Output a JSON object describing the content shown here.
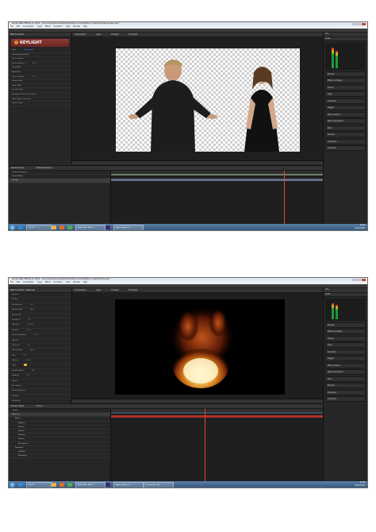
{
  "shot1": {
    "title": "Adobe After Effects CC 2014 - \\uk.local\\uk\\student\\student\\U\\Documents\\Motion Graphics\\Greenscreen.aep *",
    "menu": [
      "File",
      "Edit",
      "Composition",
      "Layer",
      "Effect",
      "Animation",
      "View",
      "Window",
      "Help"
    ],
    "effects_tab": "Effect Controls",
    "effect_name": "KEYLIGHT",
    "effect_props": [
      "View",
      "Unpremultiply Result",
      "Screen Colour",
      "Screen Balance",
      "Despill Bias",
      "Alpha Bias",
      "Screen Pre-blur",
      "Screen Matte",
      "Inside Mask",
      "Outside Mask",
      "Foreground Colour Correction",
      "Edge Colour Correction",
      "Source Crops"
    ],
    "effect_values": [
      "Final Result",
      "",
      "",
      "50.0",
      "",
      "",
      "0.0",
      "",
      "",
      "",
      "",
      "",
      ""
    ],
    "comp_tabs": [
      "Composition",
      "Layer",
      "Footage",
      "Flowchart"
    ],
    "timeline_tabs": [
      "Render Queue",
      "Untitled Sequence"
    ],
    "layers": [
      "Untitled Sequence",
      "Source Name",
      "Keylight"
    ],
    "right_panels": [
      "Info",
      "Audio",
      "Preview",
      "Effects & Presets",
      "Tracker",
      "Align",
      "Smoother",
      "Wiggler",
      "Motion Sketch",
      "Mask Interpolation",
      "Paint",
      "Brushes",
      "Paragraph",
      "Character"
    ],
    "taskbar": [
      "This PC",
      "Adobe After Effects",
      "Apple Software U..."
    ],
    "clock_time": "10:45",
    "clock_date": "01/01/2015"
  },
  "shot2": {
    "title": "Adobe After Effects CC 2014 - \\uk.local\\uk\\student\\student\\U\\Documents\\Motion Graphics\\Fire.aep *",
    "menu": [
      "File",
      "Edit",
      "Composition",
      "Layer",
      "Effect",
      "Animation",
      "View",
      "Window",
      "Help"
    ],
    "effects_tab": "Effect Controls",
    "effect_name": "Particular",
    "effect_props": [
      "Register",
      "Emitter",
      "Particles/sec",
      "Emitter Type",
      "Position XY",
      "Position Z",
      "Direction",
      "Velocity",
      "Velocity Random",
      "Particle",
      "Life [sec]",
      "Particle Type",
      "Size",
      "Opacity",
      "Color",
      "Transfer Mode",
      "Shading",
      "Physics",
      "Aux System",
      "World Transform",
      "Visibility",
      "Rendering"
    ],
    "effect_values": [
      "",
      "",
      "250",
      "Point",
      "",
      "0.0",
      "Uniform",
      "100.0",
      "20.0",
      "",
      "2.0",
      "Sprite",
      "10.0",
      "100.0",
      "",
      "Add",
      "Off",
      "",
      "",
      "",
      "",
      ""
    ],
    "comp_tabs": [
      "Composition",
      "Layer",
      "Footage",
      "Flowchart"
    ],
    "timeline_tabs": [
      "Render Queue",
      "Comp 1"
    ],
    "layers": [
      "Comp 1",
      "Particular",
      "Effects",
      "Register",
      "Emitter",
      "Particle",
      "Shading",
      "Physics",
      "Aux System",
      "Transform",
      "Visibility",
      "Rendering"
    ],
    "right_panels": [
      "Info",
      "Audio",
      "Preview",
      "Effects & Presets",
      "Tracker",
      "Align",
      "Smoother",
      "Wiggler",
      "Motion Sketch",
      "Mask Interpolation",
      "Paint",
      "Brushes",
      "Paragraph",
      "Character"
    ],
    "taskbar": [
      "This PC",
      "Adobe After Effects",
      "Apple Software U...",
      "Screenshot - Mic..."
    ],
    "clock_time": "11:20",
    "clock_date": "01/01/2015"
  },
  "colors": {
    "accent": "#4da3ff",
    "playhead": "#e8433a",
    "keylight": "#8f3a33",
    "fire": "#f2a23a"
  }
}
